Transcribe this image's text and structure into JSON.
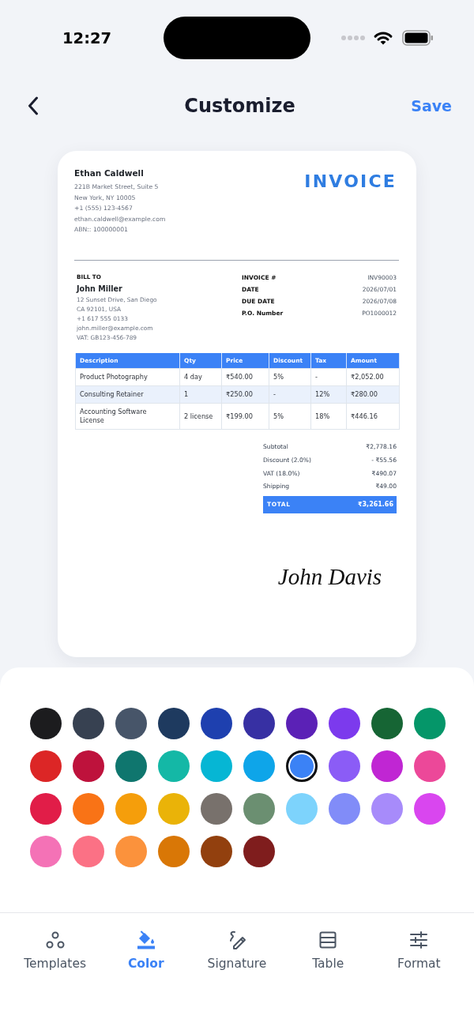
{
  "status_bar": {
    "time": "12:27"
  },
  "nav": {
    "title": "Customize",
    "action": "Save"
  },
  "invoice": {
    "sender": {
      "name": "Ethan Caldwell",
      "lines": [
        "221B Market Street, Suite 5",
        "New York, NY 10005",
        "+1 (555) 123-4567",
        "ethan.caldwell@example.com",
        "ABN:: 100000001"
      ]
    },
    "title": "INVOICE",
    "bill_to": {
      "heading": "BILL TO",
      "name": "John Miller",
      "lines": [
        "12 Sunset Drive, San Diego",
        "CA 92101, USA",
        "+1 617 555 0133",
        "john.miller@example.com",
        "VAT: GB123-456-789"
      ]
    },
    "details": [
      {
        "label": "INVOICE #",
        "value": "INV90003"
      },
      {
        "label": "DATE",
        "value": "2026/07/01"
      },
      {
        "label": "DUE DATE",
        "value": "2026/07/08"
      },
      {
        "label": "P.O. Number",
        "value": "PO1000012"
      }
    ],
    "table": {
      "columns": [
        "Description",
        "Qty",
        "Price",
        "Discount",
        "Tax",
        "Amount"
      ],
      "rows": [
        [
          "Product Photography",
          "4 day",
          "₹540.00",
          "5%",
          "-",
          "₹2,052.00"
        ],
        [
          "Consulting Retainer",
          "1",
          "₹250.00",
          "-",
          "12%",
          "₹280.00"
        ],
        [
          "Accounting Software License",
          "2 license",
          "₹199.00",
          "5%",
          "18%",
          "₹446.16"
        ]
      ]
    },
    "totals": [
      {
        "label": "Subtotal",
        "value": "₹2,778.16"
      },
      {
        "label": "Discount (2.0%)",
        "value": "- ₹55.56"
      },
      {
        "label": "VAT (18.0%)",
        "value": "₹490.07"
      },
      {
        "label": "Shipping",
        "value": "₹49.00"
      }
    ],
    "grand_total": {
      "label": "TOTAL",
      "value": "₹3,261.66"
    },
    "signature": "John Davis"
  },
  "palette": [
    {
      "color": "#1c1c1e",
      "selected": false
    },
    {
      "color": "#374151",
      "selected": false
    },
    {
      "color": "#475569",
      "selected": false
    },
    {
      "color": "#1e3a5f",
      "selected": false
    },
    {
      "color": "#1e40af",
      "selected": false
    },
    {
      "color": "#3730a3",
      "selected": false
    },
    {
      "color": "#5b21b6",
      "selected": false
    },
    {
      "color": "#7c3aed",
      "selected": false
    },
    {
      "color": "#166534",
      "selected": false
    },
    {
      "color": "#059669",
      "selected": false
    },
    {
      "color": "#dc2626",
      "selected": false
    },
    {
      "color": "#be123c",
      "selected": false
    },
    {
      "color": "#0f766e",
      "selected": false
    },
    {
      "color": "#14b8a6",
      "selected": false
    },
    {
      "color": "#06b6d4",
      "selected": false
    },
    {
      "color": "#0ea5e9",
      "selected": false
    },
    {
      "color": "#3b82f6",
      "selected": true
    },
    {
      "color": "#8b5cf6",
      "selected": false
    },
    {
      "color": "#c026d3",
      "selected": false
    },
    {
      "color": "#ec4899",
      "selected": false
    },
    {
      "color": "#e11d48",
      "selected": false
    },
    {
      "color": "#f97316",
      "selected": false
    },
    {
      "color": "#f59e0b",
      "selected": false
    },
    {
      "color": "#eab308",
      "selected": false
    },
    {
      "color": "#78716c",
      "selected": false
    },
    {
      "color": "#6b8f71",
      "selected": false
    },
    {
      "color": "#7dd3fc",
      "selected": false
    },
    {
      "color": "#818cf8",
      "selected": false
    },
    {
      "color": "#a78bfa",
      "selected": false
    },
    {
      "color": "#d946ef",
      "selected": false
    },
    {
      "color": "#f472b6",
      "selected": false
    },
    {
      "color": "#fb7185",
      "selected": false
    },
    {
      "color": "#fb923c",
      "selected": false
    },
    {
      "color": "#d97706",
      "selected": false
    },
    {
      "color": "#92400e",
      "selected": false
    },
    {
      "color": "#7f1d1d",
      "selected": false
    }
  ],
  "tabs": [
    {
      "label": "Templates",
      "selected": false
    },
    {
      "label": "Color",
      "selected": true
    },
    {
      "label": "Signature",
      "selected": false
    },
    {
      "label": "Table",
      "selected": false
    },
    {
      "label": "Format",
      "selected": false
    }
  ]
}
